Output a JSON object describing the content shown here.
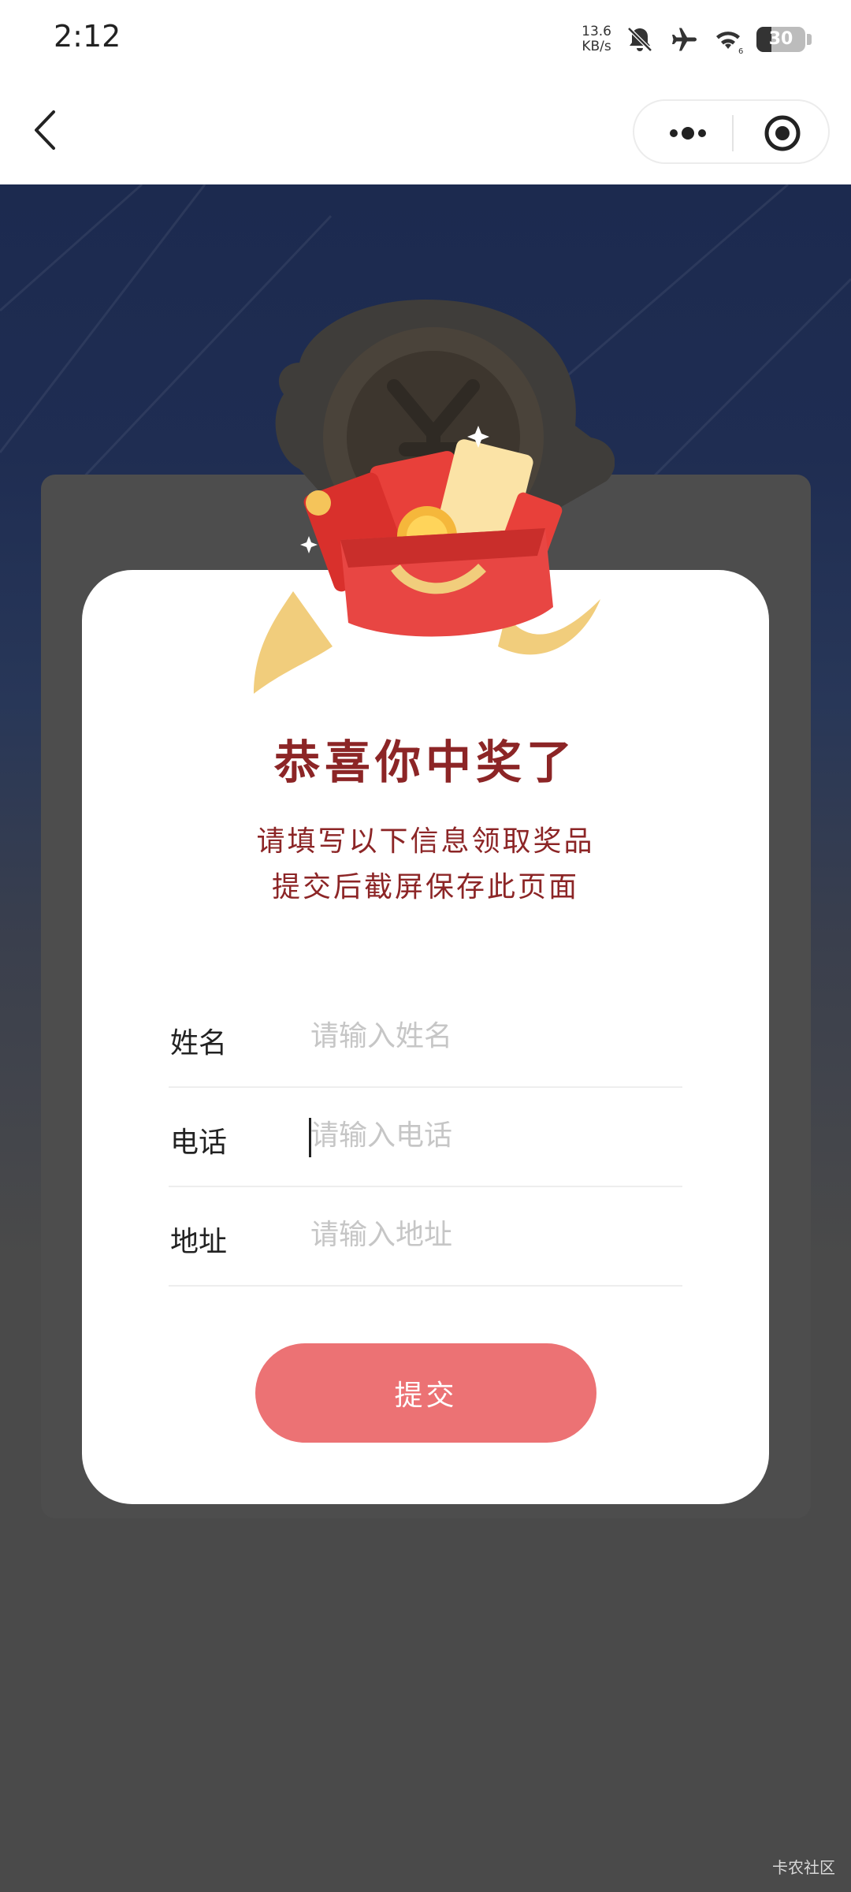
{
  "status_bar": {
    "time": "2:12",
    "net_speed_value": "13.6",
    "net_speed_unit": "KB/s",
    "battery_level": "30",
    "wifi_signal": "6",
    "icons": [
      "bell-off-icon",
      "airplane-icon",
      "wifi-icon",
      "battery-icon"
    ]
  },
  "nav": {
    "back_icon": "chevron-left-icon",
    "more_icon": "more-dots-icon",
    "close_icon": "target-close-icon"
  },
  "prize": {
    "title": "恭喜你中奖了",
    "subtitle_line1": "请填写以下信息领取奖品",
    "subtitle_line2": "提交后截屏保存此页面"
  },
  "form": {
    "fields": [
      {
        "label": "姓名",
        "placeholder": "请输入姓名",
        "value": ""
      },
      {
        "label": "电话",
        "placeholder": "请输入电话",
        "value": ""
      },
      {
        "label": "地址",
        "placeholder": "请输入地址",
        "value": ""
      }
    ],
    "submit_label": "提交"
  },
  "watermark": "卡农社区",
  "colors": {
    "title_red": "#8c2526",
    "submit_bg": "#ec7274",
    "hero_navy": "#1c2a4f",
    "page_gray": "#4a4a4a"
  }
}
